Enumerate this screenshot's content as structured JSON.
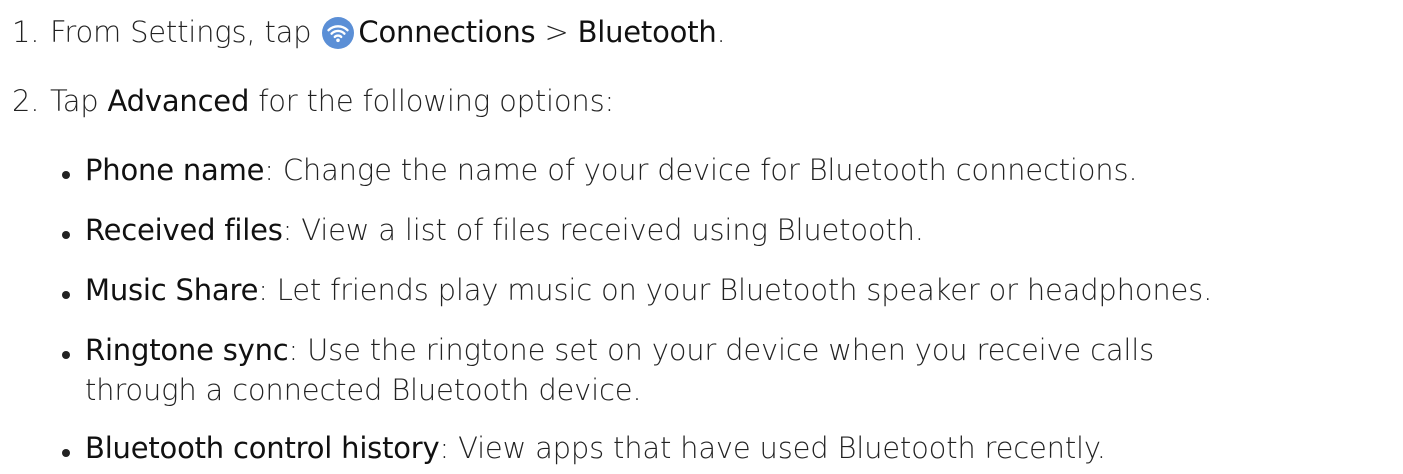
{
  "step1": {
    "number": "1.",
    "text_before": "From Settings, tap ",
    "icon": "wifi-icon",
    "icon_color": "#5b8fd6",
    "link1": "Connections",
    "separator": " > ",
    "link2": "Bluetooth",
    "suffix": "."
  },
  "step2": {
    "number": "2.",
    "text_before": "Tap ",
    "link": "Advanced",
    "text_after": " for the following options:"
  },
  "options": [
    {
      "label": "Phone name",
      "desc": ": Change the name of your device for Bluetooth connections."
    },
    {
      "label": "Received files",
      "desc": ": View a list of files received using Bluetooth."
    },
    {
      "label": "Music Share",
      "desc": ": Let friends play music on your Bluetooth speaker or headphones."
    },
    {
      "label": "Ringtone sync",
      "desc": ": Use the ringtone set on your device when you receive calls",
      "desc_line2": "through a connected Bluetooth device."
    },
    {
      "label": "Bluetooth control history",
      "desc": ": View apps that have used Bluetooth recently."
    }
  ]
}
